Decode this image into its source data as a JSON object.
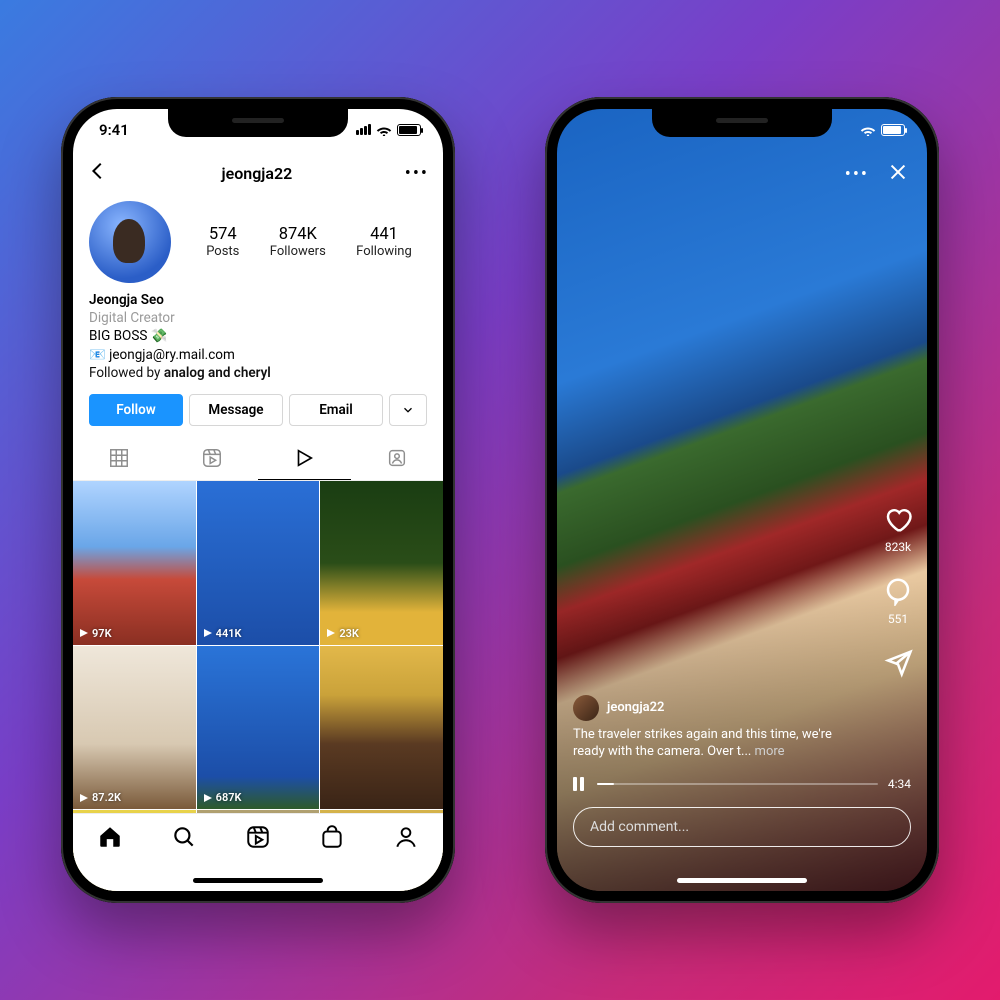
{
  "status": {
    "time": "9:41"
  },
  "left": {
    "username": "jeongja22",
    "stats": [
      {
        "value": "574",
        "label": "Posts"
      },
      {
        "value": "874K",
        "label": "Followers"
      },
      {
        "value": "441",
        "label": "Following"
      }
    ],
    "bio": {
      "name": "Jeongja Seo",
      "role": "Digital Creator",
      "line1": "BIG BOSS 💸",
      "email": "📧 jeongja@ry.mail.com",
      "followed_prefix": "Followed by ",
      "followed_names": "analog and cheryl"
    },
    "buttons": {
      "follow": "Follow",
      "message": "Message",
      "email": "Email"
    },
    "grid_views": [
      {
        "views": "97K"
      },
      {
        "views": "441K"
      },
      {
        "views": "23K"
      },
      {
        "views": "87.2K"
      },
      {
        "views": "687K"
      },
      {
        "views": ""
      },
      {
        "views": ""
      },
      {
        "views": ""
      },
      {
        "views": ""
      }
    ]
  },
  "right": {
    "username": "jeongja22",
    "likes": "823k",
    "comments": "551",
    "caption": "The traveler strikes again and this time, we're ready with the camera. Over t...",
    "more": " more",
    "duration": "4:34",
    "comment_placeholder": "Add comment..."
  }
}
